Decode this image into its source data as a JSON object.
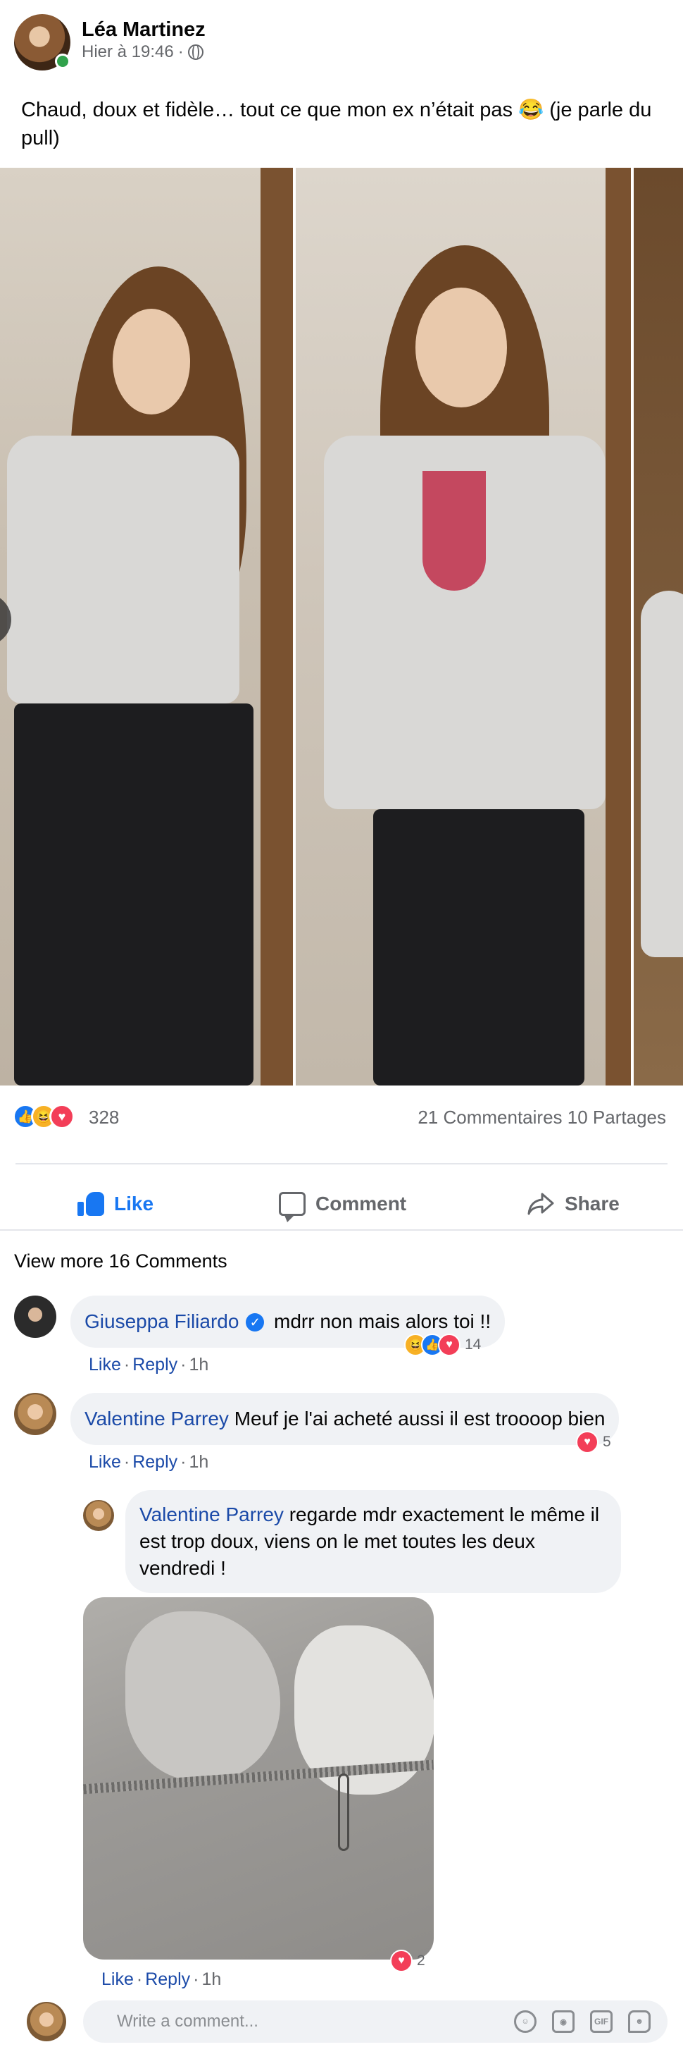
{
  "post": {
    "author": "Léa Martinez",
    "time": "Hier à 19:46",
    "separator": "·",
    "text": "Chaud, doux et fidèle… tout ce que mon ex n’était pas 😂 (je parle du pull)"
  },
  "stats": {
    "reaction_count": "328",
    "reactions": [
      "like-icon",
      "haha-icon",
      "love-icon"
    ],
    "comments": "21 Commentaires",
    "shares": "10 Partages"
  },
  "actions": {
    "like": "Like",
    "comment": "Comment",
    "share": "Share"
  },
  "comments_section": {
    "view_more": "View more 16 Comments",
    "write_placeholder": "Write a comment...",
    "gif_label": "GIF"
  },
  "comments": [
    {
      "name": "Giuseppa Filiardo",
      "verified": true,
      "text": "mdrr non mais alors toi !!",
      "like": "Like",
      "reply": "Reply",
      "time": "1h",
      "reactions": [
        "haha-icon",
        "like-icon",
        "love-icon"
      ],
      "reaction_count": "14"
    },
    {
      "name": "Valentine Parrey",
      "text": "Meuf je l'ai acheté aussi il est troooop bien",
      "like": "Like",
      "reply": "Reply",
      "time": "1h",
      "reactions": [
        "love-icon"
      ],
      "reaction_count": "5"
    },
    {
      "name": "Valentine Parrey",
      "text": "regarde mdr exactement le même il est trop doux, viens on le met toutes les deux vendredi !",
      "like": "Like",
      "reply": "Reply",
      "time": "1h",
      "reactions": [
        "love-icon"
      ],
      "reaction_count": "2"
    }
  ],
  "colors": {
    "accent": "#1877f2",
    "name_link": "#1b4aa8",
    "muted": "#65676b",
    "bubble": "#f0f2f5",
    "online": "#31a24c",
    "love": "#f33e58",
    "haha": "#f7b125"
  }
}
